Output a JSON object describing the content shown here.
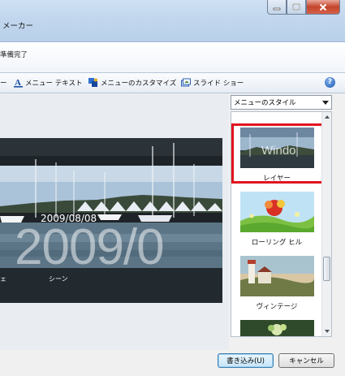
{
  "app": {
    "title_partial": "メーカー"
  },
  "status": {
    "text": "準備完了"
  },
  "toolbar": {
    "partial_label": "ー",
    "menu_text": "メニュー テキスト",
    "customize_menu": "メニューのカスタマイズ",
    "slideshow": "スライド ショー",
    "help_glyph": "?"
  },
  "preview": {
    "date_small": "2009/08/08",
    "date_big": "2009/0",
    "menu_item_partial": "ェ",
    "menu_item_scene": "シーン"
  },
  "style_dropdown": {
    "selected": "メニューのスタイル"
  },
  "styles": [
    {
      "label": "レイヤー",
      "thumb_text": "Windo",
      "selected": true
    },
    {
      "label": "ローリング ヒル",
      "selected": false
    },
    {
      "label": "ヴィンテージ",
      "selected": false
    },
    {
      "label": "",
      "selected": false
    }
  ],
  "buttons": {
    "write": "書き込み(U)",
    "cancel": "キャンセル"
  },
  "icons": {
    "minimize": "minimize-icon",
    "maximize": "maximize-icon",
    "close": "close-icon",
    "menu_text": "text-icon",
    "customize": "palette-icon",
    "slideshow": "slideshow-icon",
    "help": "help-icon",
    "dropdown": "chevron-down-icon"
  },
  "colors": {
    "selection_frame": "#e0151f",
    "help": "#1c57b4"
  }
}
